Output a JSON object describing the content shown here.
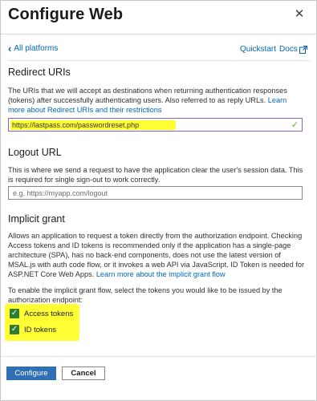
{
  "header": {
    "title": "Configure Web",
    "close_icon": "close-icon"
  },
  "nav": {
    "back_label": "All platforms",
    "quickstart_label": "Quickstart",
    "docs_label": "Docs"
  },
  "redirect": {
    "heading": "Redirect URIs",
    "description": "The URIs that we will accept as destinations when returning authentication responses (tokens) after successfully authenticating users. Also referred to as reply URLs.",
    "learn_more": "Learn more about Redirect URIs and their restrictions",
    "value": "https://lastpass.com/passwordreset.php"
  },
  "logout": {
    "heading": "Logout URL",
    "description": "This is where we send a request to have the application clear the user's session data. This is required for single sign-out to work correctly.",
    "placeholder": "e.g. https://myapp.com/logout"
  },
  "implicit": {
    "heading": "Implicit grant",
    "description": "Allows an application to request a token directly from the authorization endpoint. Checking Access tokens and ID tokens is recommended only if the application has a single-page architecture (SPA), has no back-end components, does not use the latest version of MSAL.js with auth code flow, or it invokes a web API via JavaScript. ID Token is needed for ASP.NET Core Web Apps.",
    "learn_more": "Learn more about the implicit grant flow",
    "instruction": "To enable the implicit grant flow, select the tokens you would like to be issued by the authorization endpoint:",
    "access_tokens_label": "Access tokens",
    "access_tokens_checked": true,
    "id_tokens_label": "ID tokens",
    "id_tokens_checked": true
  },
  "footer": {
    "configure_label": "Configure",
    "cancel_label": "Cancel"
  },
  "colors": {
    "accent": "#0067b8",
    "primary_button": "#2f6fb5",
    "checkbox": "#2f7d32",
    "highlight": "#ffff33"
  }
}
